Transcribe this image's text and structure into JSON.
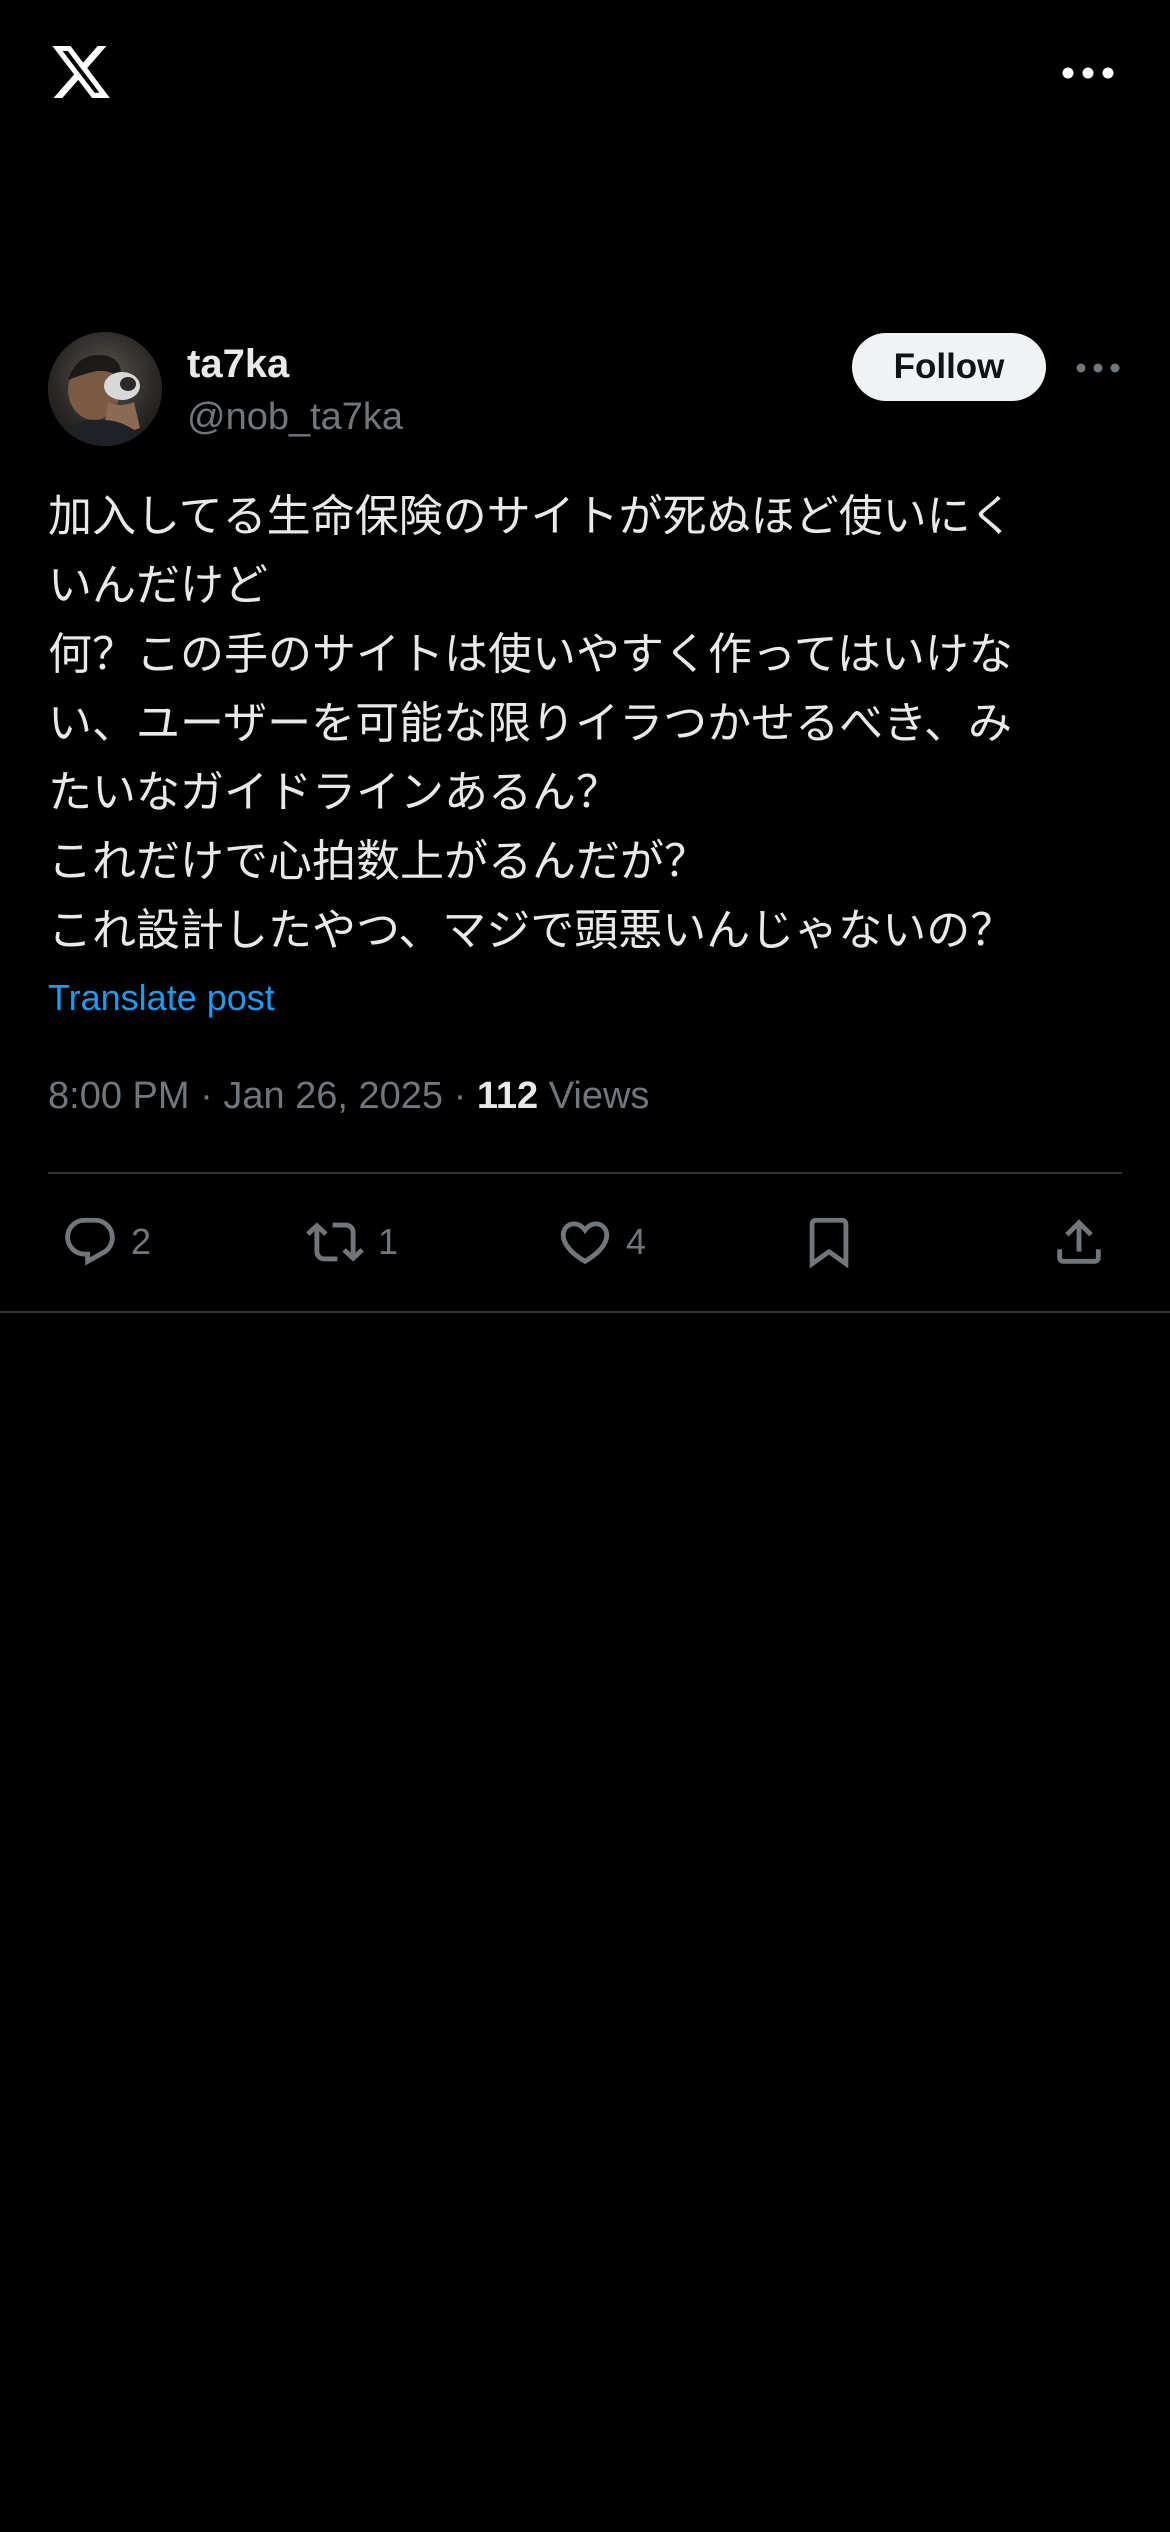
{
  "header": {
    "logo_icon": "x-logo-icon",
    "more_icon": "more-horizontal-icon"
  },
  "post": {
    "author": {
      "name": "ta7ka",
      "handle": "@nob_ta7ka"
    },
    "follow_label": "Follow",
    "text_lines": [
      "加入してる生命保険のサイトが死ぬほど使いにく",
      "いんだけど",
      "何？この手のサイトは使いやすく作ってはいけな",
      "い、ユーザーを可能な限りイラつかせるべき、み",
      "たいなガイドラインあるん？",
      "これだけで心拍数上がるんだが？",
      "これ設計したやつ、マジで頭悪いんじゃないの？"
    ],
    "translate_label": "Translate post",
    "time": "8:00 PM",
    "separator": "·",
    "date": "Jan 26, 2025",
    "views_count": "112",
    "views_label": "Views"
  },
  "actions": {
    "replies": "2",
    "reposts": "1",
    "likes": "4"
  },
  "colors": {
    "background": "#000000",
    "text": "#e7e9ea",
    "secondary": "#71767b",
    "link": "#1d9bf0",
    "divider": "#2f3336",
    "follow_bg": "#eff3f4"
  }
}
